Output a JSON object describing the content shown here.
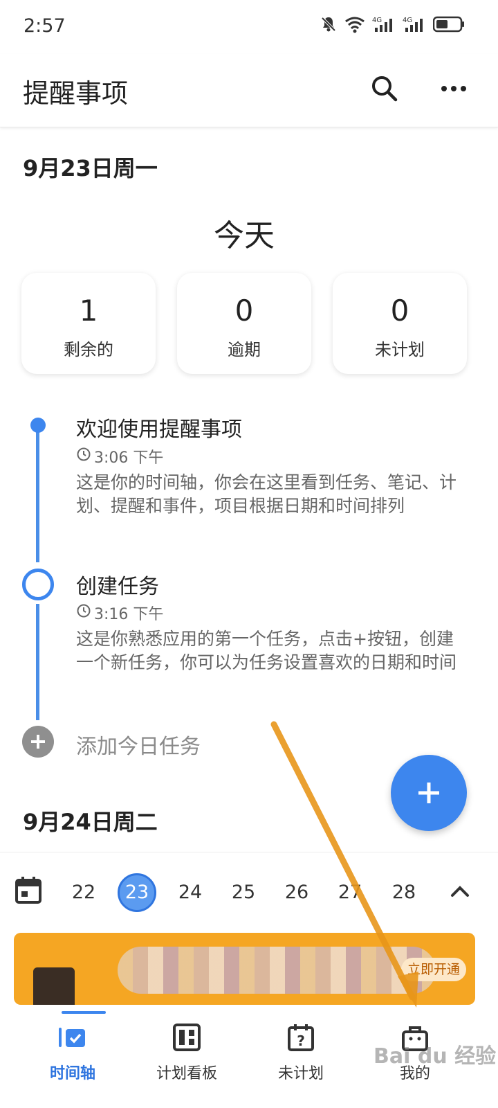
{
  "status_bar": {
    "time": "2:57",
    "icons": [
      "bell-off-icon",
      "wifi-icon",
      "signal-4g-icon",
      "signal-4g-icon",
      "battery-icon"
    ],
    "signal_label": "4G"
  },
  "app_bar": {
    "title": "提醒事项",
    "search_icon": "search-icon",
    "more_icon": "more-icon"
  },
  "sections": [
    {
      "date": "9月23日周一",
      "heading": "今天",
      "stats": [
        {
          "value": "1",
          "label": "剩余的"
        },
        {
          "value": "0",
          "label": "逾期"
        },
        {
          "value": "0",
          "label": "未计划"
        }
      ],
      "timeline": [
        {
          "title": "欢迎使用提醒事项",
          "time": "3:06 下午",
          "description": "这是你的时间轴，你会在这里看到任务、笔记、计划、提醒和事件，项目根据日期和时间排列",
          "completed": true
        },
        {
          "title": "创建任务",
          "time": "3:16 下午",
          "description": "这是你熟悉应用的第一个任务，点击+按钮，创建一个新任务，你可以为任务设置喜欢的日期和时间",
          "completed": false
        }
      ],
      "add_task_label": "添加今日任务"
    },
    {
      "date": "9月24日周二"
    }
  ],
  "week_strip": {
    "days": [
      "22",
      "23",
      "24",
      "25",
      "26",
      "27",
      "28"
    ],
    "selected": "23"
  },
  "promo": {
    "button_label": "立即开通"
  },
  "bottom_nav": [
    {
      "label": "时间轴",
      "icon": "timeline-icon",
      "active": true
    },
    {
      "label": "计划看板",
      "icon": "board-icon",
      "active": false
    },
    {
      "label": "未计划",
      "icon": "unplanned-icon",
      "active": false
    },
    {
      "label": "我的",
      "icon": "profile-bag-icon",
      "active": false
    }
  ],
  "watermark": "Bai du 经验",
  "colors": {
    "accent": "#3d86ee",
    "promo": "#f5a623",
    "arrow": "#e8961a"
  }
}
